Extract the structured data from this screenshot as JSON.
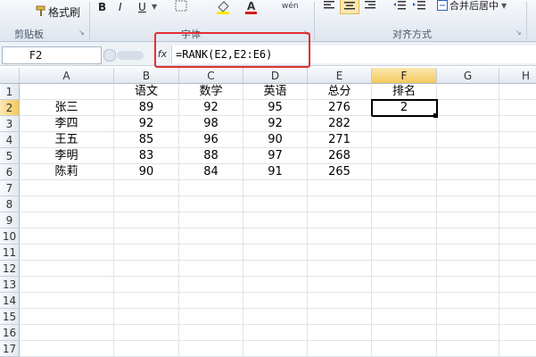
{
  "ribbon": {
    "format_painter": "格式刷",
    "bold": "B",
    "italic": "I",
    "underline": "U",
    "merge_center": "合并后居中",
    "group_clipboard": "剪贴板",
    "group_font": "字体",
    "group_alignment": "对齐方式",
    "phonetic": "wén"
  },
  "formula_bar": {
    "name_box": "F2",
    "fx": "fx",
    "formula": "=RANK(E2,E2:E6)"
  },
  "grid": {
    "columns": [
      "A",
      "B",
      "C",
      "D",
      "E",
      "F",
      "G",
      "H"
    ],
    "rows": [
      "1",
      "2",
      "3",
      "4",
      "5",
      "6",
      "7",
      "8",
      "9",
      "10",
      "11",
      "12",
      "13",
      "14",
      "15",
      "16",
      "17"
    ],
    "header": [
      "",
      "语文",
      "数学",
      "英语",
      "总分",
      "排名"
    ],
    "data": [
      [
        "张三",
        "89",
        "92",
        "95",
        "276",
        "2"
      ],
      [
        "李四",
        "92",
        "98",
        "92",
        "282",
        ""
      ],
      [
        "王五",
        "85",
        "96",
        "90",
        "271",
        ""
      ],
      [
        "李明",
        "83",
        "88",
        "97",
        "268",
        ""
      ],
      [
        "陈莉",
        "90",
        "84",
        "91",
        "265",
        ""
      ]
    ]
  },
  "colors": {
    "highlight_box": "#e03030",
    "selected_header": "#f4c95c"
  }
}
